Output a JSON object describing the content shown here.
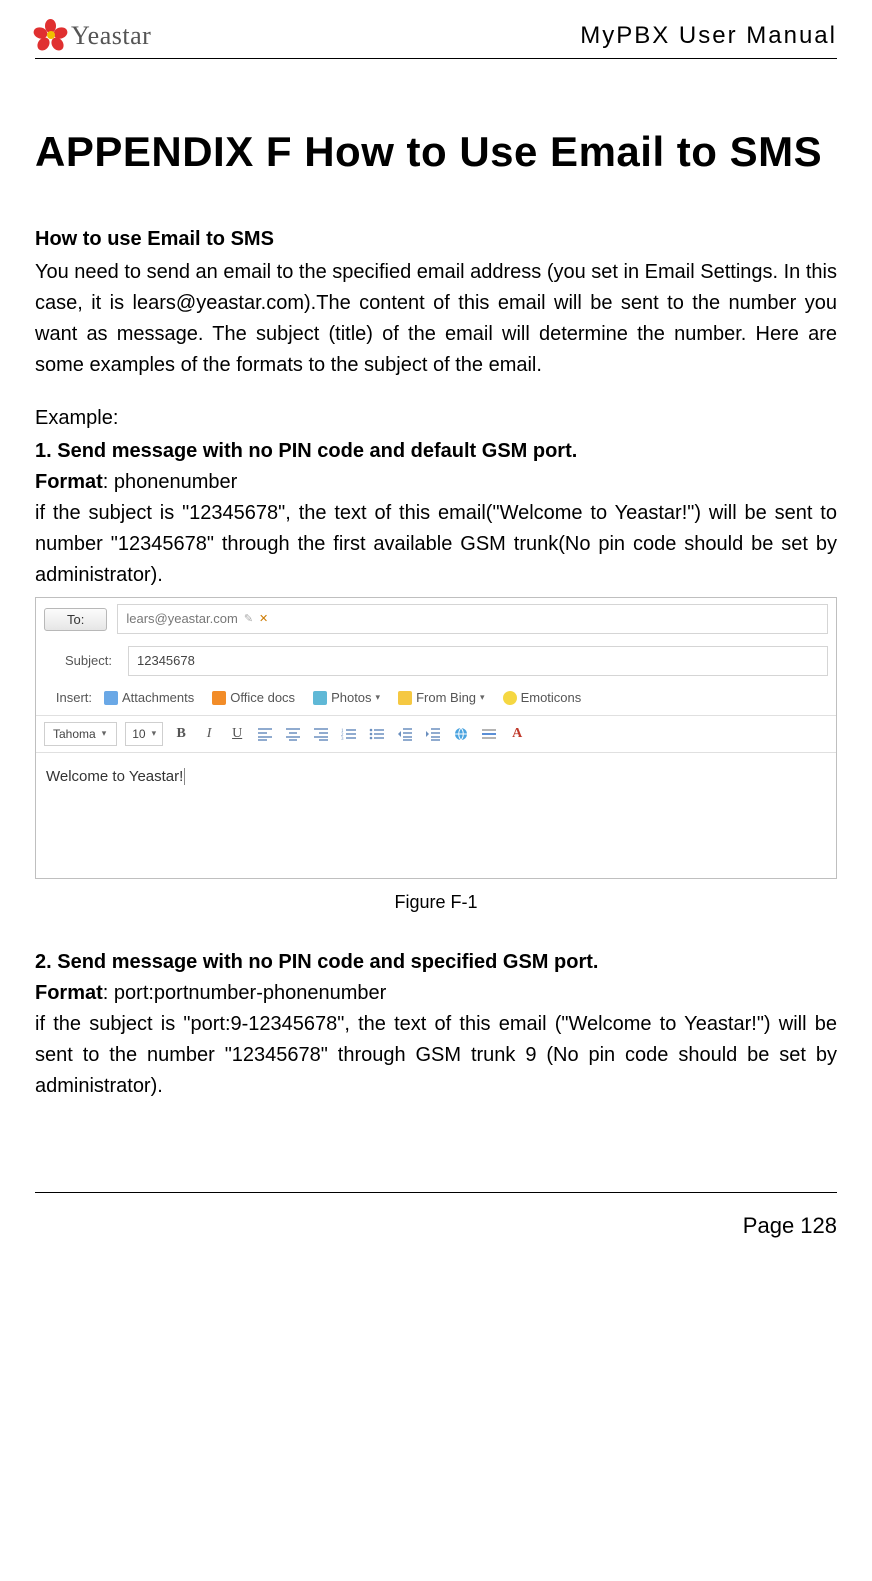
{
  "header": {
    "brand": "Yeastar",
    "doc_title": "MyPBX User Manual"
  },
  "title": "APPENDIX F How to Use Email to SMS",
  "section_heading": "How to use Email to SMS",
  "intro": "You need to send an email to the specified email address (you set in Email Settings. In this case, it is lears@yeastar.com).The content of this email will be sent to the number you want as message. The subject (title) of the email will determine the number. Here are some examples of the formats to the subject of the email.",
  "example_label": "Example:",
  "ex1": {
    "title": "1. Send message with no PIN code and default GSM port.",
    "format_label": "Format",
    "format_value": ": phonenumber",
    "desc": "if the subject is \"12345678\", the text of this email(\"Welcome to Yeastar!\") will be sent to number \"12345678\" through the first available GSM trunk(No pin code should be set by administrator)."
  },
  "email": {
    "to_label": "To:",
    "to_value": "lears@yeastar.com",
    "subject_label": "Subject:",
    "subject_value": "12345678",
    "insert_label": "Insert:",
    "insert_items": [
      "Attachments",
      "Office docs",
      "Photos",
      "From Bing",
      "Emoticons"
    ],
    "font_name": "Tahoma",
    "font_size": "10",
    "compose_text": "Welcome to Yeastar!"
  },
  "figure_caption": "Figure F-1",
  "ex2": {
    "title": "2. Send message with no PIN code and specified GSM port.",
    "format_label": "Format",
    "format_value": ": port:portnumber-phonenumber",
    "desc": "if the subject is \"port:9-12345678\", the text of this email (\"Welcome to Yeastar!\") will be sent to the number \"12345678\" through GSM trunk 9 (No pin code should be set by administrator)."
  },
  "footer": {
    "page_label": "Page 128"
  }
}
